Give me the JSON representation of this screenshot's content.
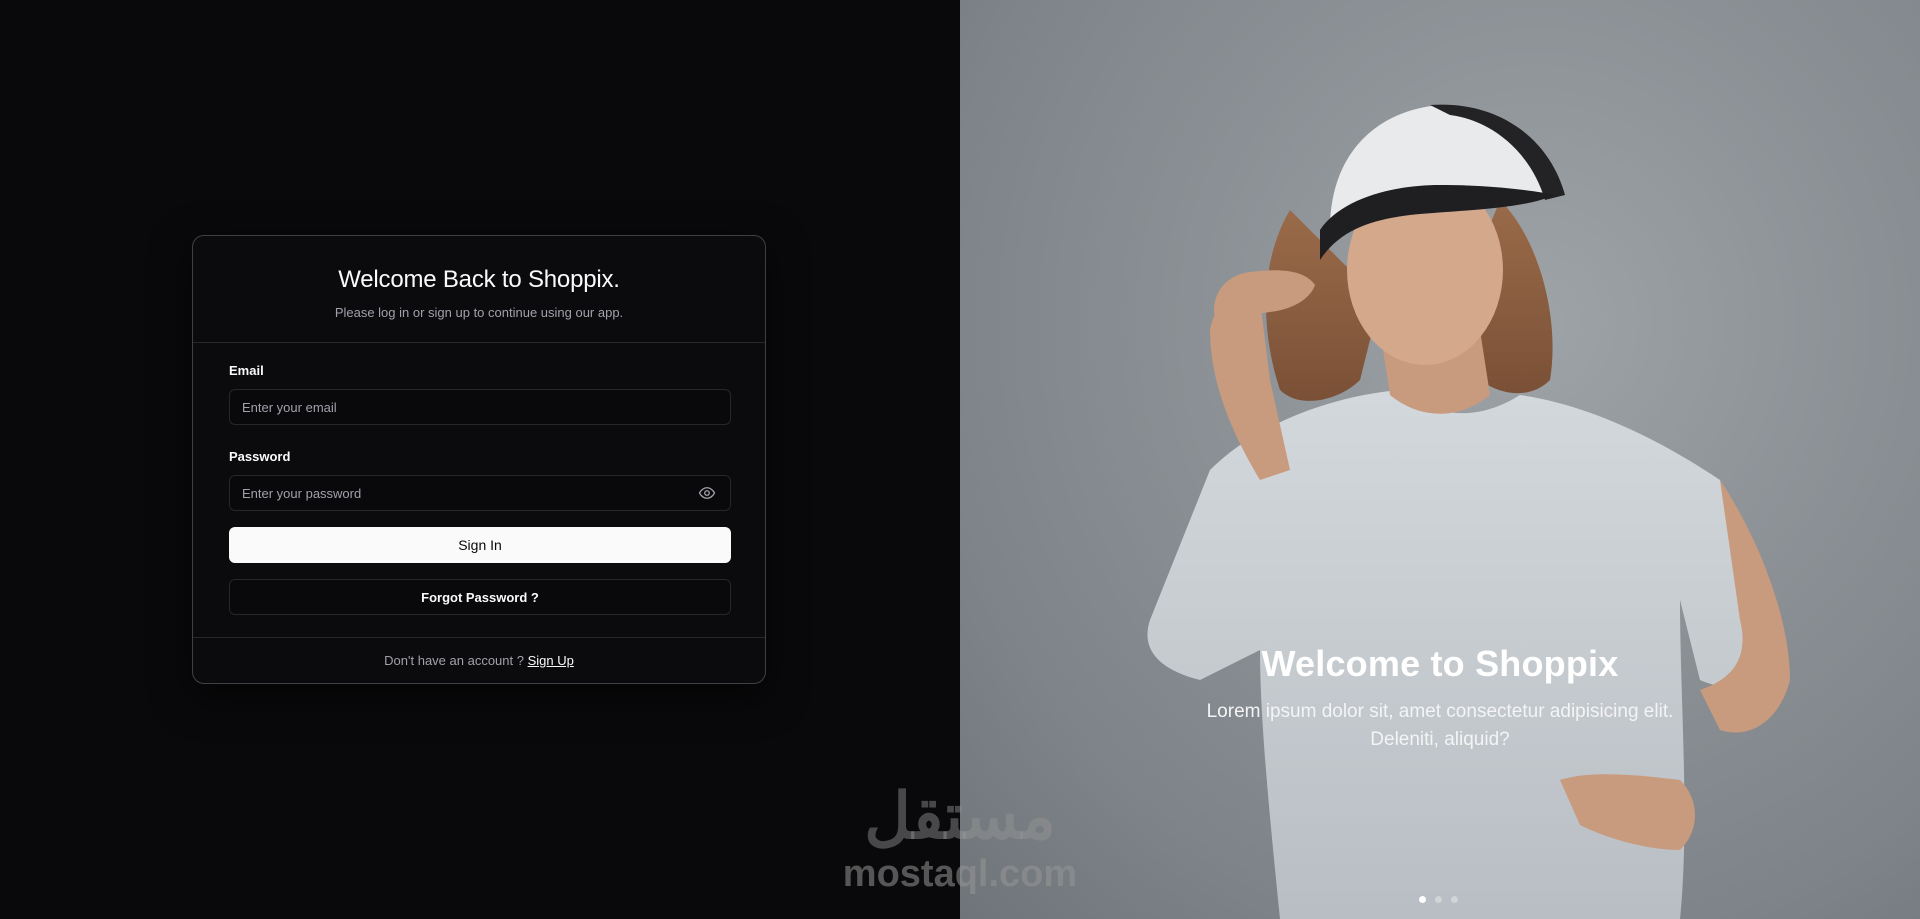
{
  "login": {
    "title": "Welcome Back to Shoppix.",
    "subtitle": "Please log in or sign up to continue using our app.",
    "email_label": "Email",
    "email_placeholder": "Enter your email",
    "password_label": "Password",
    "password_placeholder": "Enter your password",
    "sign_in_label": "Sign In",
    "forgot_label": "Forgot Password ?",
    "footer_text": "Don't have an account ?",
    "sign_up_label": "Sign Up"
  },
  "hero": {
    "title": "Welcome to Shoppix",
    "text": "Lorem ipsum dolor sit, amet consectetur adipisicing elit. Deleniti, aliquid?",
    "slides": 3,
    "active_slide": 1
  },
  "watermark": {
    "arabic": "مستقل",
    "latin": "mostaql.com"
  },
  "colors": {
    "background": "#09090b",
    "card_border": "#3f3f46",
    "primary_button": "#fafafa",
    "muted_text": "#a1a1aa"
  },
  "icons": {
    "password_toggle": "eye-icon"
  }
}
